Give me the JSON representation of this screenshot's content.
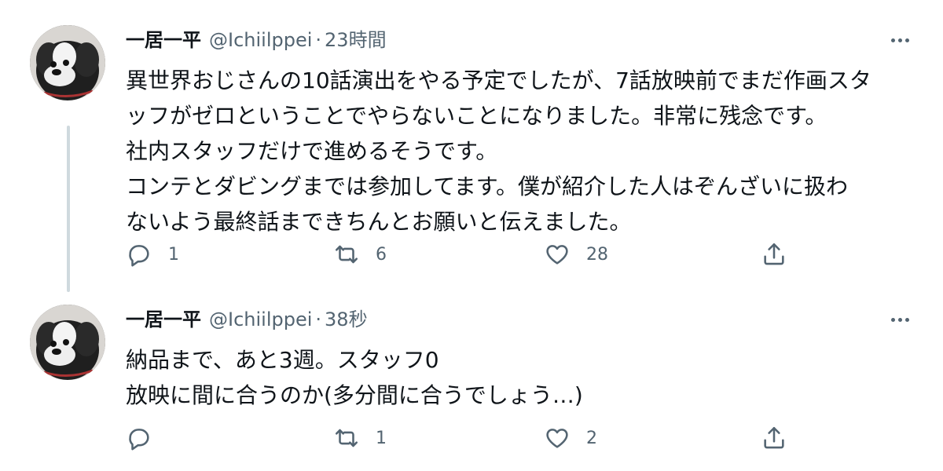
{
  "tweets": [
    {
      "display_name": "一居一平",
      "handle": "@Ichiilppei",
      "separator": "·",
      "timestamp": "23時間",
      "text_lines": [
        "異世界おじさんの10話演出をやる予定でしたが、7話放映前でまだ作画スタ",
        "ッフがゼロということでやらないことになりました。非常に残念です。",
        "社内スタッフだけで進めるそうです。",
        "コンテとダビングまでは参加してます。僕が紹介した人はぞんざいに扱わ",
        "ないよう最終話まできちんとお願いと伝えました。"
      ],
      "reply_count": "1",
      "retweet_count": "6",
      "like_count": "28",
      "avatar_icon": "dog-avatar-icon",
      "icons": {
        "more": "more-options-icon",
        "reply": "reply-icon",
        "retweet": "retweet-icon",
        "like": "heart-icon",
        "share": "share-icon"
      }
    },
    {
      "display_name": "一居一平",
      "handle": "@Ichiilppei",
      "separator": "·",
      "timestamp": "38秒",
      "text_lines": [
        "納品まで、あと3週。スタッフ0",
        "放映に間に合うのか(多分間に合うでしょう…)"
      ],
      "reply_count": "",
      "retweet_count": "1",
      "like_count": "2",
      "avatar_icon": "dog-avatar-icon",
      "icons": {
        "more": "more-options-icon",
        "reply": "reply-icon",
        "retweet": "retweet-icon",
        "like": "heart-icon",
        "share": "share-icon"
      }
    }
  ],
  "colors": {
    "text_primary": "#0f1419",
    "text_secondary": "#536471",
    "thread_line": "#cfd9de",
    "background": "#ffffff"
  }
}
